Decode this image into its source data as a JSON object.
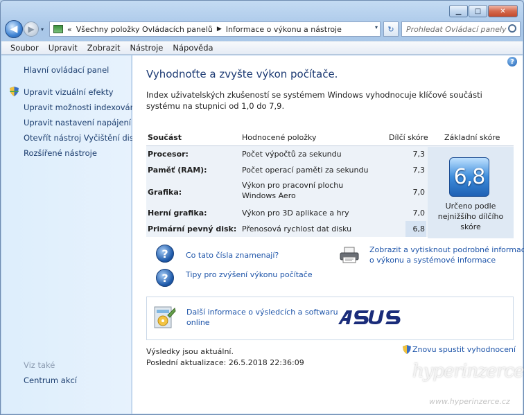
{
  "window": {
    "caption_buttons": {
      "minimize": "▁",
      "maximize": "□",
      "close": "✕"
    }
  },
  "address_bar": {
    "back_glyph": "◀",
    "forward_glyph": "▶",
    "prefix": "«",
    "crumb_1": "Všechny položky Ovládacích panelů",
    "crumb_sep": "▶",
    "crumb_2": "Informace o výkonu a nástroje",
    "dropdown_glyph": "▾",
    "refresh_glyph": "↻",
    "search_placeholder": "Prohledat Ovládací panely"
  },
  "menu": {
    "items": [
      "Soubor",
      "Upravit",
      "Zobrazit",
      "Nástroje",
      "Nápověda"
    ]
  },
  "sidebar": {
    "home": "Hlavní ovládací panel",
    "links": [
      "Upravit vizuální efekty",
      "Upravit možnosti indexování",
      "Upravit nastavení napájení",
      "Otevřít nástroj Vyčištění disku",
      "Rozšířené nástroje"
    ],
    "see_also": "Viz také",
    "action_center": "Centrum akcí"
  },
  "content": {
    "help_glyph": "?",
    "title": "Vyhodnoťte a zvyšte výkon počítače.",
    "description": "Index uživatelských zkušeností se systémem Windows vyhodnocuje klíčové součásti systému na stupnici od 1,0 do 7,9.",
    "table": {
      "headers": {
        "component": "Součást",
        "rated": "Hodnocené položky",
        "subscore": "Dílčí skóre",
        "base": "Základní skóre"
      },
      "rows": [
        {
          "component": "Procesor:",
          "rated": "Počet výpočtů za sekundu",
          "subscore": "7,3"
        },
        {
          "component": "Paměť (RAM):",
          "rated": "Počet operací paměti za sekundu",
          "subscore": "7,3"
        },
        {
          "component": "Grafika:",
          "rated": "Výkon pro pracovní plochu Windows Aero",
          "subscore": "7,0"
        },
        {
          "component": "Herní grafika:",
          "rated": "Výkon pro 3D aplikace a hry",
          "subscore": "7,0"
        },
        {
          "component": "Primární pevný disk:",
          "rated": "Přenosová rychlost dat disku",
          "subscore": "6,8"
        }
      ],
      "base_score": "6,8",
      "base_caption": "Určeno podle nejnižšího dílčího skóre"
    },
    "links": {
      "q_glyph": "?",
      "meaning": "Co tato čísla znamenají?",
      "tips": "Tipy pro zvýšení výkonu počítače",
      "print_line1": "Zobrazit a vytisknout podrobné informace",
      "print_line2": "o výkonu a systémové informace"
    },
    "infobox": {
      "line1": "Další informace o výsledcích a softwaru",
      "line2": "online"
    },
    "status": {
      "line1": "Výsledky jsou aktuální.",
      "line2": "Poslední aktualizace: 26.5.2018 22:36:09"
    },
    "rerun": "Znovu spustit vyhodnocení"
  },
  "watermark": {
    "brand": "hyperinzerce",
    "url": "www.hyperinzerce.cz"
  },
  "colors": {
    "accent_link": "#1c53a8",
    "title": "#1c3a73",
    "score_badge": "#3d8cdb",
    "asus_logo": "#1a2c7a"
  }
}
